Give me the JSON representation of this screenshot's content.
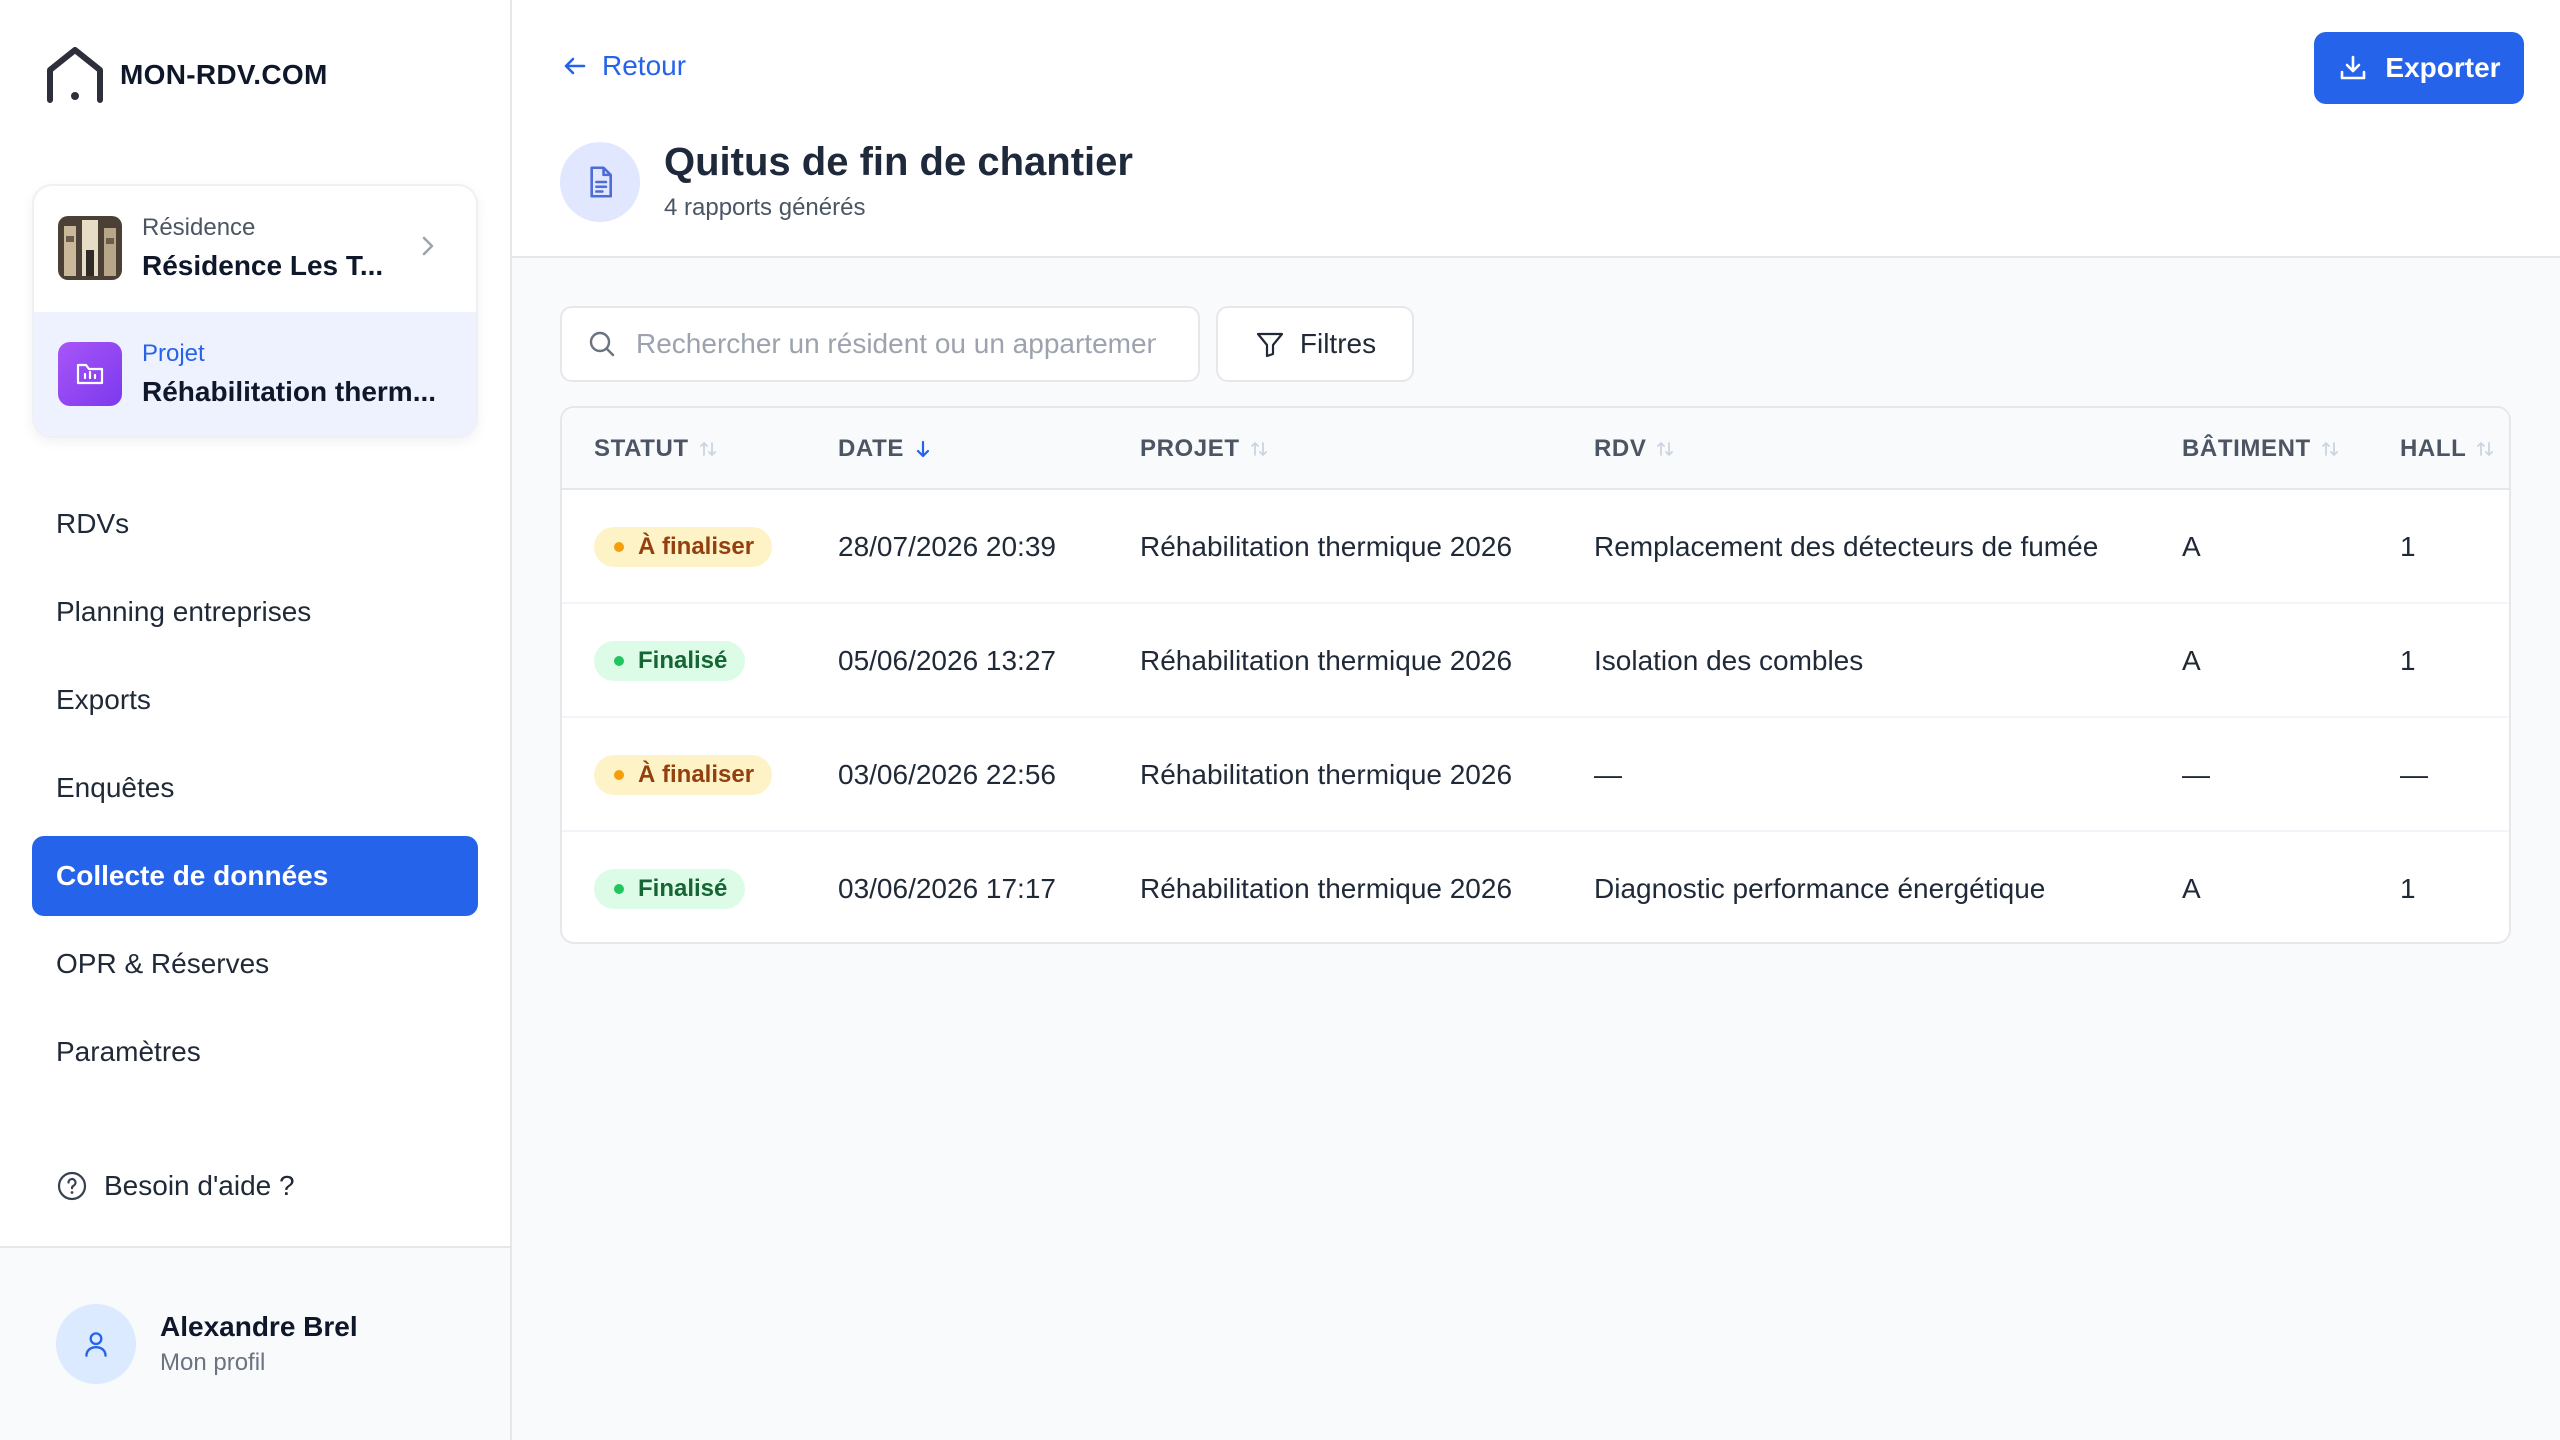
{
  "app": {
    "brand": "MON-RDV.COM"
  },
  "context": {
    "residence_label": "Résidence",
    "residence_value": "Résidence Les T...",
    "project_label": "Projet",
    "project_value": "Réhabilitation therm..."
  },
  "nav": {
    "items": [
      {
        "label": "RDVs"
      },
      {
        "label": "Planning entreprises"
      },
      {
        "label": "Exports"
      },
      {
        "label": "Enquêtes"
      },
      {
        "label": "Collecte de données",
        "active": true
      },
      {
        "label": "OPR & Réserves"
      },
      {
        "label": "Paramètres"
      }
    ],
    "help": "Besoin d'aide ?"
  },
  "user": {
    "name": "Alexandre Brel",
    "subtitle": "Mon profil"
  },
  "header": {
    "back": "Retour",
    "export": "Exporter",
    "title": "Quitus de fin de chantier",
    "subtitle": "4 rapports générés"
  },
  "toolbar": {
    "search_placeholder": "Rechercher un résident ou un appartement",
    "search_value": "",
    "filters": "Filtres"
  },
  "table": {
    "columns": [
      "STATUT",
      "DATE",
      "PROJET",
      "RDV",
      "BÂTIMENT",
      "HALL"
    ],
    "sorted_column": "DATE",
    "rows": [
      {
        "status": "À finaliser",
        "status_kind": "warn",
        "date": "28/07/2026 20:39",
        "projet": "Réhabilitation thermique 2026",
        "rdv": "Remplacement des détecteurs de fumée",
        "batiment": "A",
        "hall": "1"
      },
      {
        "status": "Finalisé",
        "status_kind": "ok",
        "date": "05/06/2026 13:27",
        "projet": "Réhabilitation thermique 2026",
        "rdv": "Isolation des combles",
        "batiment": "A",
        "hall": "1"
      },
      {
        "status": "À finaliser",
        "status_kind": "warn",
        "date": "03/06/2026 22:56",
        "projet": "Réhabilitation thermique 2026",
        "rdv": "—",
        "batiment": "—",
        "hall": "—"
      },
      {
        "status": "Finalisé",
        "status_kind": "ok",
        "date": "03/06/2026 17:17",
        "projet": "Réhabilitation thermique 2026",
        "rdv": "Diagnostic performance énergétique",
        "batiment": "A",
        "hall": "1"
      }
    ]
  },
  "colors": {
    "accent": "#2563eb",
    "warn_bg": "#fef3c7",
    "ok_bg": "#dcfce7"
  }
}
